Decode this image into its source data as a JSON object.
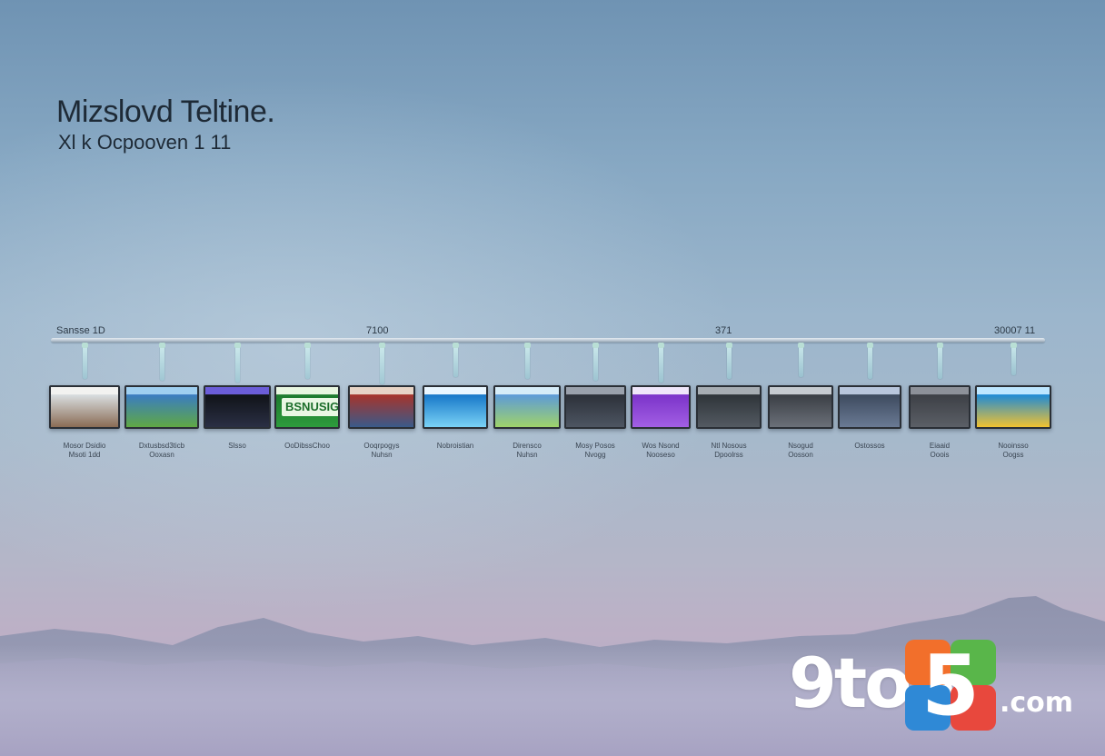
{
  "title": "Mizslovd Teltine.",
  "subtitle": "Xl k Ocpooven 1 11",
  "timeline": {
    "years": [
      "Sansse 1D",
      "7100",
      "371",
      "30007 11"
    ],
    "items": [
      {
        "label": "Mosor Dsidio\nMsoti 1dd",
        "screen": [
          "#d9dee0",
          "#8a6c55",
          "#f2f2f0"
        ]
      },
      {
        "label": "Dxtusbsd3ticb\nOoxasn",
        "screen": [
          "#3b7cc2",
          "#5fa844",
          "#9fcff0"
        ]
      },
      {
        "label": "Slsso",
        "screen": [
          "#101318",
          "#2a2f44",
          "#6b5dd8"
        ]
      },
      {
        "label": "OoDibssChoo",
        "screen": [
          "#1d7a2e",
          "#2d9b3c",
          "#e8f6e0"
        ],
        "badge": "BSNUSIG"
      },
      {
        "label": "Ooqrpogys\nNuhsn",
        "screen": [
          "#a7342b",
          "#3a5a8a",
          "#e7d4c6"
        ]
      },
      {
        "label": "Nobroistian",
        "screen": [
          "#1677c8",
          "#7ad2f6",
          "#e9f6ff"
        ]
      },
      {
        "label": "Dirensco\nNuhsn",
        "screen": [
          "#5d9ad8",
          "#9fd36a",
          "#d6ecf8"
        ]
      },
      {
        "label": "Mosy Posos\nNvogg",
        "screen": [
          "#2c3139",
          "#4d5562",
          "#9aa1ac"
        ]
      },
      {
        "label": "Wos Nsond\nNooseso",
        "screen": [
          "#7b33c9",
          "#a25fe4",
          "#efe6fa"
        ]
      },
      {
        "label": "Ntl Nosous\nDpoolrss",
        "screen": [
          "#2f3439",
          "#535a62",
          "#a7adb3"
        ]
      },
      {
        "label": "Nsogud\nOosson",
        "screen": [
          "#3a3e44",
          "#6b7079",
          "#c6cbd0"
        ]
      },
      {
        "label": "Ostossos",
        "screen": [
          "#3d4a5e",
          "#6a7a94",
          "#b8c6dc"
        ]
      },
      {
        "label": "Eiaaid\nOoois",
        "screen": [
          "#3d4046",
          "#5b5f66",
          "#8d9199"
        ]
      },
      {
        "label": "Nooinsso\nOogss",
        "screen": [
          "#1d8ad6",
          "#f2c230",
          "#bde6ff"
        ]
      }
    ]
  },
  "logo": {
    "main": "9to5",
    "suffix": ".com"
  },
  "colors": {
    "logo_orange": "#f26f2b",
    "logo_green": "#59b64a",
    "logo_blue": "#2f89d6",
    "logo_red": "#e8483d"
  }
}
